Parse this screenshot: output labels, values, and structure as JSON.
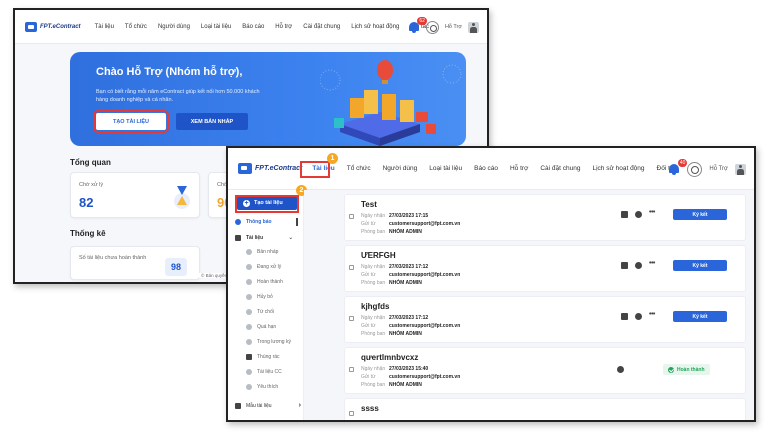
{
  "app": {
    "logo_text": "FPT.eContract",
    "nav_items": [
      "Tài liệu",
      "Tổ chức",
      "Người dùng",
      "Loại tài liệu",
      "Báo cáo",
      "Hỗ trợ",
      "Cài đặt chung",
      "Lịch sử hoạt động",
      "Đối tác"
    ],
    "notification_count_1": "62",
    "notification_count_2": "40",
    "user_name": "Hỗ Trợ",
    "accent_color": "#2a66d9",
    "highlight_color": "#e53935"
  },
  "dashboard": {
    "hero_title": "Chào Hỗ Trợ (Nhóm hỗ trợ),",
    "hero_subtitle": "Bạn có biết rằng mỗi năm eContract giúp kết nối hơn 50.000 khách hàng doanh nghiệp và cá nhân.",
    "create_button": "TẠO TÀI LIỆU",
    "draft_button": "XEM BẢN NHÁP",
    "overview_title": "Tổng quan",
    "pending_label": "Chờ xử lý",
    "pending_value": "82",
    "second_label": "Chờ",
    "second_value": "90",
    "stats_title": "Thống kê",
    "unfinished_label": "Số tài liệu chưa hoàn thành",
    "unfinished_value": "98",
    "footer_text": "© Bản quyền"
  },
  "documents_view": {
    "step1": "1",
    "step2": "2",
    "sidebar": {
      "create_label": "Tạo tài liệu",
      "notifications": "Thông báo",
      "documents": "Tài liệu",
      "sub_items": [
        "Bản nháp",
        "Đang xử lý",
        "Hoàn thành",
        "Hủy bỏ",
        "Từ chối",
        "Quá hạn",
        "Trong lương ký",
        "Thùng rác",
        "Tài liệu CC",
        "Yêu thích"
      ],
      "templates": "Mẫu tài liệu"
    },
    "labels": {
      "received": "Ngày nhận",
      "sender": "Gửi từ",
      "department": "Phòng ban"
    },
    "documents": [
      {
        "title": "Test",
        "date": "27/03/2023 17:15",
        "sender": "customersupport@fpt.com.vn",
        "department": "NHÓM ADMIN",
        "action": "Ký kết"
      },
      {
        "title": "ƯERFGH",
        "date": "27/03/2023 17:12",
        "sender": "customersupport@fpt.com.vn",
        "department": "NHÓM ADMIN",
        "action": "Ký kết"
      },
      {
        "title": "kjhgfds",
        "date": "27/03/2023 17:12",
        "sender": "customersupport@fpt.com.vn",
        "department": "NHÓM ADMIN",
        "action": "Ký kết"
      },
      {
        "title": "qưertlmnbvcxz",
        "date": "27/03/2023 15:40",
        "sender": "customersupport@fpt.com.vn",
        "department": "NHÓM ADMIN",
        "action": "Hoàn thành"
      },
      {
        "title": "ssss",
        "date": "",
        "sender": "",
        "department": "",
        "action": ""
      }
    ]
  }
}
